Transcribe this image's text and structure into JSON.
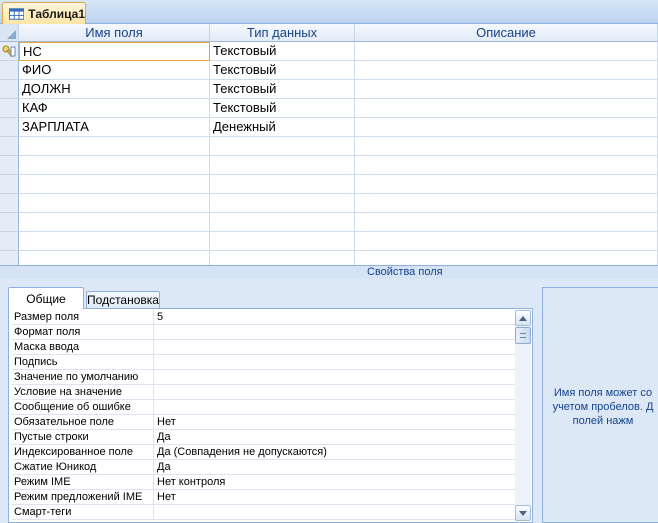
{
  "document_tab": {
    "label": "Таблица1",
    "icon": "table-icon"
  },
  "grid": {
    "headers": {
      "name": "Имя поля",
      "type": "Тип данных",
      "description": "Описание"
    },
    "rows": [
      {
        "name": "НС",
        "type": "Текстовый",
        "description": "",
        "primary_key": true
      },
      {
        "name": "ФИО",
        "type": "Текстовый",
        "description": ""
      },
      {
        "name": "ДОЛЖН",
        "type": "Текстовый",
        "description": ""
      },
      {
        "name": "КАФ",
        "type": "Текстовый",
        "description": ""
      },
      {
        "name": "ЗАРПЛАТА",
        "type": "Денежный",
        "description": ""
      },
      {
        "name": "",
        "type": "",
        "description": ""
      },
      {
        "name": "",
        "type": "",
        "description": ""
      },
      {
        "name": "",
        "type": "",
        "description": ""
      },
      {
        "name": "",
        "type": "",
        "description": ""
      },
      {
        "name": "",
        "type": "",
        "description": ""
      },
      {
        "name": "",
        "type": "",
        "description": ""
      },
      {
        "name": "",
        "type": "",
        "description": ""
      }
    ]
  },
  "properties": {
    "title": "Свойства поля",
    "tabs": {
      "general": "Общие",
      "lookup": "Подстановка"
    },
    "rows": [
      {
        "label": "Размер поля",
        "value": "5"
      },
      {
        "label": "Формат поля",
        "value": ""
      },
      {
        "label": "Маска ввода",
        "value": ""
      },
      {
        "label": "Подпись",
        "value": ""
      },
      {
        "label": "Значение по умолчанию",
        "value": ""
      },
      {
        "label": "Условие на значение",
        "value": ""
      },
      {
        "label": "Сообщение об ошибке",
        "value": ""
      },
      {
        "label": "Обязательное поле",
        "value": "Нет"
      },
      {
        "label": "Пустые строки",
        "value": "Да"
      },
      {
        "label": "Индексированное поле",
        "value": "Да (Совпадения не допускаются)"
      },
      {
        "label": "Сжатие Юникод",
        "value": "Да"
      },
      {
        "label": "Режим IME",
        "value": "Нет контроля"
      },
      {
        "label": "Режим предложений IME",
        "value": "Нет"
      },
      {
        "label": "Смарт-теги",
        "value": ""
      }
    ],
    "help_lines": [
      "Имя поля может со",
      "учетом пробелов. Д",
      "полей нажм"
    ]
  },
  "colors": {
    "accent": "#15428b",
    "active_border": "#e8a23a"
  }
}
